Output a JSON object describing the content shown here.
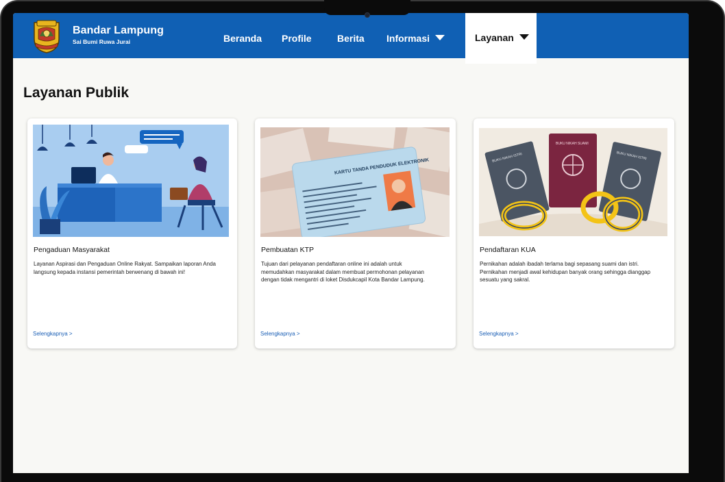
{
  "brand": {
    "title": "Bandar Lampung",
    "subtitle": "Sai Bumi Ruwa Jurai",
    "logo_icon": "city-crest-icon",
    "logo_text": "KOTA BANDAR LAMPUNG"
  },
  "nav": {
    "items": [
      {
        "label": "Beranda"
      },
      {
        "label": "Profile"
      },
      {
        "label": "Berita"
      },
      {
        "label": "Informasi"
      },
      {
        "label": "Layanan"
      }
    ],
    "active": "Layanan"
  },
  "page": {
    "title": "Layanan Publik"
  },
  "cards": [
    {
      "title": "Pengaduan Masyarakat",
      "description": "Layanan Aspirasi dan Pengaduan Online Rakyat. Sampaikan laporan Anda langsung kepada instansi pemerintah berwenang di bawah ini!",
      "link": "Selengkapnya >",
      "image_icon": "customer-service-illustration"
    },
    {
      "title": "Pembuatan KTP",
      "description": "Tujuan dari pelayanan pendaftaran online ini adalah untuk memudahkan masyarakat dalam membuat permohonan pelayanan dengan tidak mengantri di loket Disdukcapil Kota Bandar Lampung.",
      "link": "Selengkapnya >",
      "image_icon": "id-card-photo",
      "card_text": "KARTU TANDA PENDUDUK ELEKTRONIK"
    },
    {
      "title": "Pendaftaran KUA",
      "description": "Pernikahan adalah ibadah terlama bagi sepasang suami dan istri. Pernikahan menjadi awal kehidupan banyak orang sehingga dianggap sesuatu yang sakral.",
      "link": "Selengkapnya >",
      "image_icon": "marriage-books-rings-illustration",
      "book_labels": [
        "BUKU NIKAH ISTRI",
        "BUKU NIKAH SUAMI",
        "BUKU NIKAH ISTRI"
      ]
    }
  ],
  "colors": {
    "navbar": "#1060b4",
    "link": "#1b5fb5",
    "background": "#f8f8f5"
  }
}
